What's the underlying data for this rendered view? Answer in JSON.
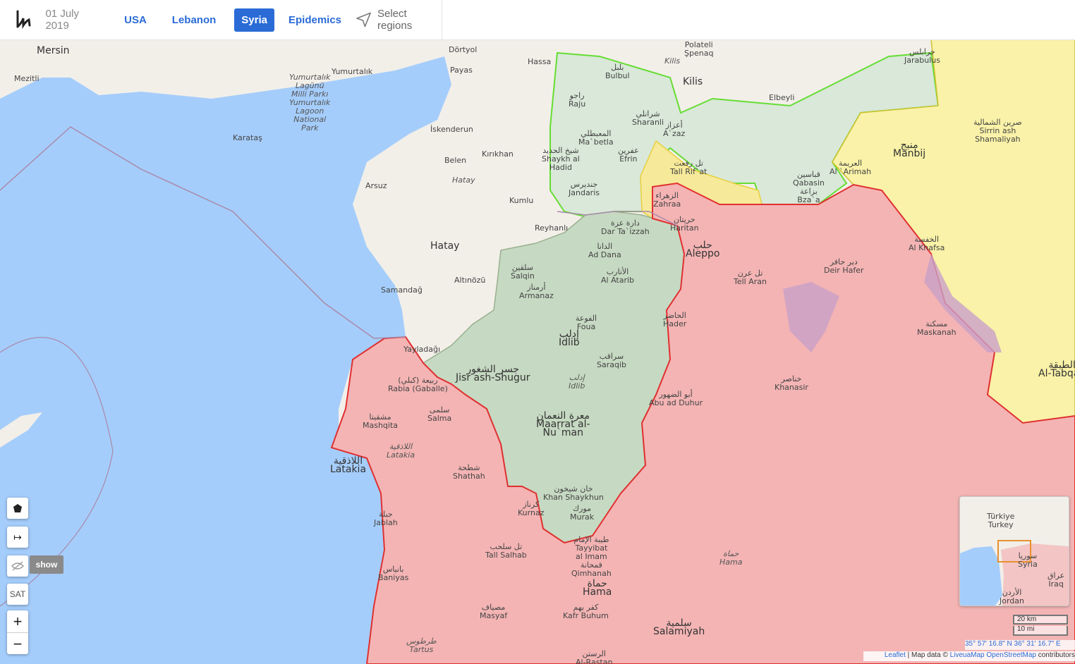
{
  "header": {
    "date": "01 July 2019",
    "nav": [
      "USA",
      "Lebanon",
      "Syria",
      "Epidemics"
    ],
    "active": "Syria",
    "select_regions": "Select regions"
  },
  "map_labels": [
    {
      "id": "mersin",
      "text": "Mersin",
      "big": true
    },
    {
      "id": "mezitli",
      "text": "Mezitli"
    },
    {
      "id": "yumurtalik",
      "text": "Yumurtalık"
    },
    {
      "id": "lagoon",
      "text": "Yumurtalık\nLagünü\nMilli Parkı\nYumurtalık\nLagoon\nNational\nPark",
      "it": true
    },
    {
      "id": "karatas",
      "text": "Karataş"
    },
    {
      "id": "dortyol",
      "text": "Dörtyol"
    },
    {
      "id": "payas",
      "text": "Payas"
    },
    {
      "id": "iskenderun",
      "text": "İskenderun"
    },
    {
      "id": "belen",
      "text": "Belen"
    },
    {
      "id": "kirikhan",
      "text": "Kırıkhan"
    },
    {
      "id": "hatay_it",
      "text": "Hatay",
      "it": true
    },
    {
      "id": "arsuz",
      "text": "Arsuz"
    },
    {
      "id": "kumlu",
      "text": "Kumlu"
    },
    {
      "id": "reyhanli",
      "text": "Reyhanlı"
    },
    {
      "id": "hatay",
      "text": "Hatay",
      "big": true
    },
    {
      "id": "altinozu",
      "text": "Altınözü"
    },
    {
      "id": "samandag",
      "text": "Samandağ"
    },
    {
      "id": "yayladagi",
      "text": "Yayladağı"
    },
    {
      "id": "hassa",
      "text": "Hassa"
    },
    {
      "id": "polateli",
      "text": "Polateli\nŞpenaq"
    },
    {
      "id": "kilis_it",
      "text": "Kilis",
      "it": true
    },
    {
      "id": "kilis",
      "text": "Kilis",
      "big": true
    },
    {
      "id": "elbeyli",
      "text": "Elbeyli"
    },
    {
      "id": "jarabulus",
      "text": "جرابلس\nJarabulus"
    },
    {
      "id": "bulbul",
      "text": "بلبل\nBulbul"
    },
    {
      "id": "raju",
      "text": "راجو\nRaju"
    },
    {
      "id": "sharanli",
      "text": "شرانلي\nSharanli"
    },
    {
      "id": "azaz",
      "text": "أعزاز\nA`zaz"
    },
    {
      "id": "mabtla",
      "text": "المعبطلي\nMa`betla"
    },
    {
      "id": "efrin",
      "text": "عفرين\nEfrin"
    },
    {
      "id": "shaykh",
      "text": "شيخ الحديد\nShaykh al\nHadid"
    },
    {
      "id": "tallrifat",
      "text": "تل رفعت\nTall Rif`at"
    },
    {
      "id": "jandaris",
      "text": "جنديرس\nJandaris"
    },
    {
      "id": "qabasin",
      "text": "قباسين\nQabasin\nبزاعة\nBza`a"
    },
    {
      "id": "manbij",
      "text": "منبج\nManbij",
      "big": true
    },
    {
      "id": "alarimah",
      "text": "العريمة\nAl `Arimah"
    },
    {
      "id": "sirrin",
      "text": "صرين الشمالية\nSirrin ash\nShamaliyah"
    },
    {
      "id": "zahraa",
      "text": "الزهراء\nZahraa"
    },
    {
      "id": "darta",
      "text": "دارة عزة\nDar Ta`izzah"
    },
    {
      "id": "haritan",
      "text": "حريتان\nHaritan"
    },
    {
      "id": "aleppo",
      "text": "حلب\nAleppo",
      "big": true
    },
    {
      "id": "alkhafsa",
      "text": "الخفسة\nAl Khafsa"
    },
    {
      "id": "deirhafer",
      "text": "دير حافر\nDeir Hafer"
    },
    {
      "id": "tellaran",
      "text": "تل عرن\nTell Aran"
    },
    {
      "id": "addana",
      "text": "الدانا\nAd Dana"
    },
    {
      "id": "salqin",
      "text": "سلقين\nSalqin"
    },
    {
      "id": "alatarib",
      "text": "الأتارب\nAl Atarib"
    },
    {
      "id": "armanaz",
      "text": "أرمناز\nArmanaz"
    },
    {
      "id": "foua",
      "text": "الفوعة\nFoua"
    },
    {
      "id": "idlib",
      "text": "إدلب\nIdlib",
      "big": true
    },
    {
      "id": "hader",
      "text": "الحاضر\nHader"
    },
    {
      "id": "maskanah",
      "text": "مسكنة\nMaskanah"
    },
    {
      "id": "tabqah",
      "text": "الطبقة\nAl-Tabqah",
      "big": true
    },
    {
      "id": "jisr",
      "text": "جسر الشغور\nJisr ash-Shugur",
      "big": true
    },
    {
      "id": "saraqib",
      "text": "سراقب\nSaraqib"
    },
    {
      "id": "idlib_it",
      "text": "إدلب\nIdlib",
      "it": true
    },
    {
      "id": "rabia",
      "text": "ربيعة (كبلي)\nRabia (Gaballe)"
    },
    {
      "id": "khanasir",
      "text": "خناصر\nKhanasir"
    },
    {
      "id": "abuduhur",
      "text": "أبو الضهور\nAbu ad Duhur"
    },
    {
      "id": "mashqita",
      "text": "مشقيتا\nMashqita"
    },
    {
      "id": "salma",
      "text": "سلمى\nSalma"
    },
    {
      "id": "maarrat",
      "text": "معرة النعمان\nMaarrat al-\nNu`man",
      "big": true
    },
    {
      "id": "latakia_it",
      "text": "اللاذقية\nLatakia",
      "it": true
    },
    {
      "id": "latakia",
      "text": "اللاذقية\nLatakia",
      "big": true
    },
    {
      "id": "shathah",
      "text": "شطحة\nShathah"
    },
    {
      "id": "khanshaykhun",
      "text": "خان شيخون\nKhan Shaykhun"
    },
    {
      "id": "kurnaz",
      "text": "كرناز\nKurnaz"
    },
    {
      "id": "murak",
      "text": "مورك\nMurak"
    },
    {
      "id": "jablah",
      "text": "جبلة\nJablah"
    },
    {
      "id": "tallsalhab",
      "text": "تل سلحب\nTall Salhab"
    },
    {
      "id": "tayyibat",
      "text": "طيبة الإمام\nTayyibat\nal Imam\nقمحانة\nQimhanah"
    },
    {
      "id": "hama_it",
      "text": "حماة\nHama",
      "it": true
    },
    {
      "id": "baniyas",
      "text": "بانياس\nBaniyas"
    },
    {
      "id": "hama",
      "text": "حماة\nHama",
      "big": true
    },
    {
      "id": "masyaf",
      "text": "مصياف\nMasyaf"
    },
    {
      "id": "kafrbuhum",
      "text": "كفر بهم\nKafr Buhum"
    },
    {
      "id": "salamiyah",
      "text": "سلمية\nSalamiyah",
      "big": true
    },
    {
      "id": "tartus",
      "text": "طرطوس\nTartus",
      "it": true
    },
    {
      "id": "alrastan",
      "text": "الرستن\nAl-Rastan"
    }
  ],
  "controls": {
    "show_label": "show",
    "sat_label": "SAT",
    "zoom_in": "+",
    "zoom_out": "−",
    "line_icon": "↦"
  },
  "minimap": {
    "turkiye": "Türkiye\nTurkey",
    "syria": "سوريا\nSyria",
    "jordan": "الأردن\nJordan",
    "iraq": "عراق\nIraq"
  },
  "scale": {
    "km": "20 km",
    "mi": "10 mi"
  },
  "coords": "35° 57' 16.8\" N 36° 31' 16.7\" E",
  "attribution": {
    "leaflet": "Leaflet",
    "mapdata": " | Map data © ",
    "liveua": "LiveuaMap",
    "osm": "OpenStreetMap",
    "contributors": " contributors"
  },
  "colors": {
    "sea": "#a5cdfb",
    "land": "#f2efe9",
    "regime": "#f4b4b4",
    "opposition": "#c6d9c2",
    "turkish_backed": "#d9e8d8",
    "sdf": "#f9f2a8",
    "accent": "#2a6bd6"
  }
}
